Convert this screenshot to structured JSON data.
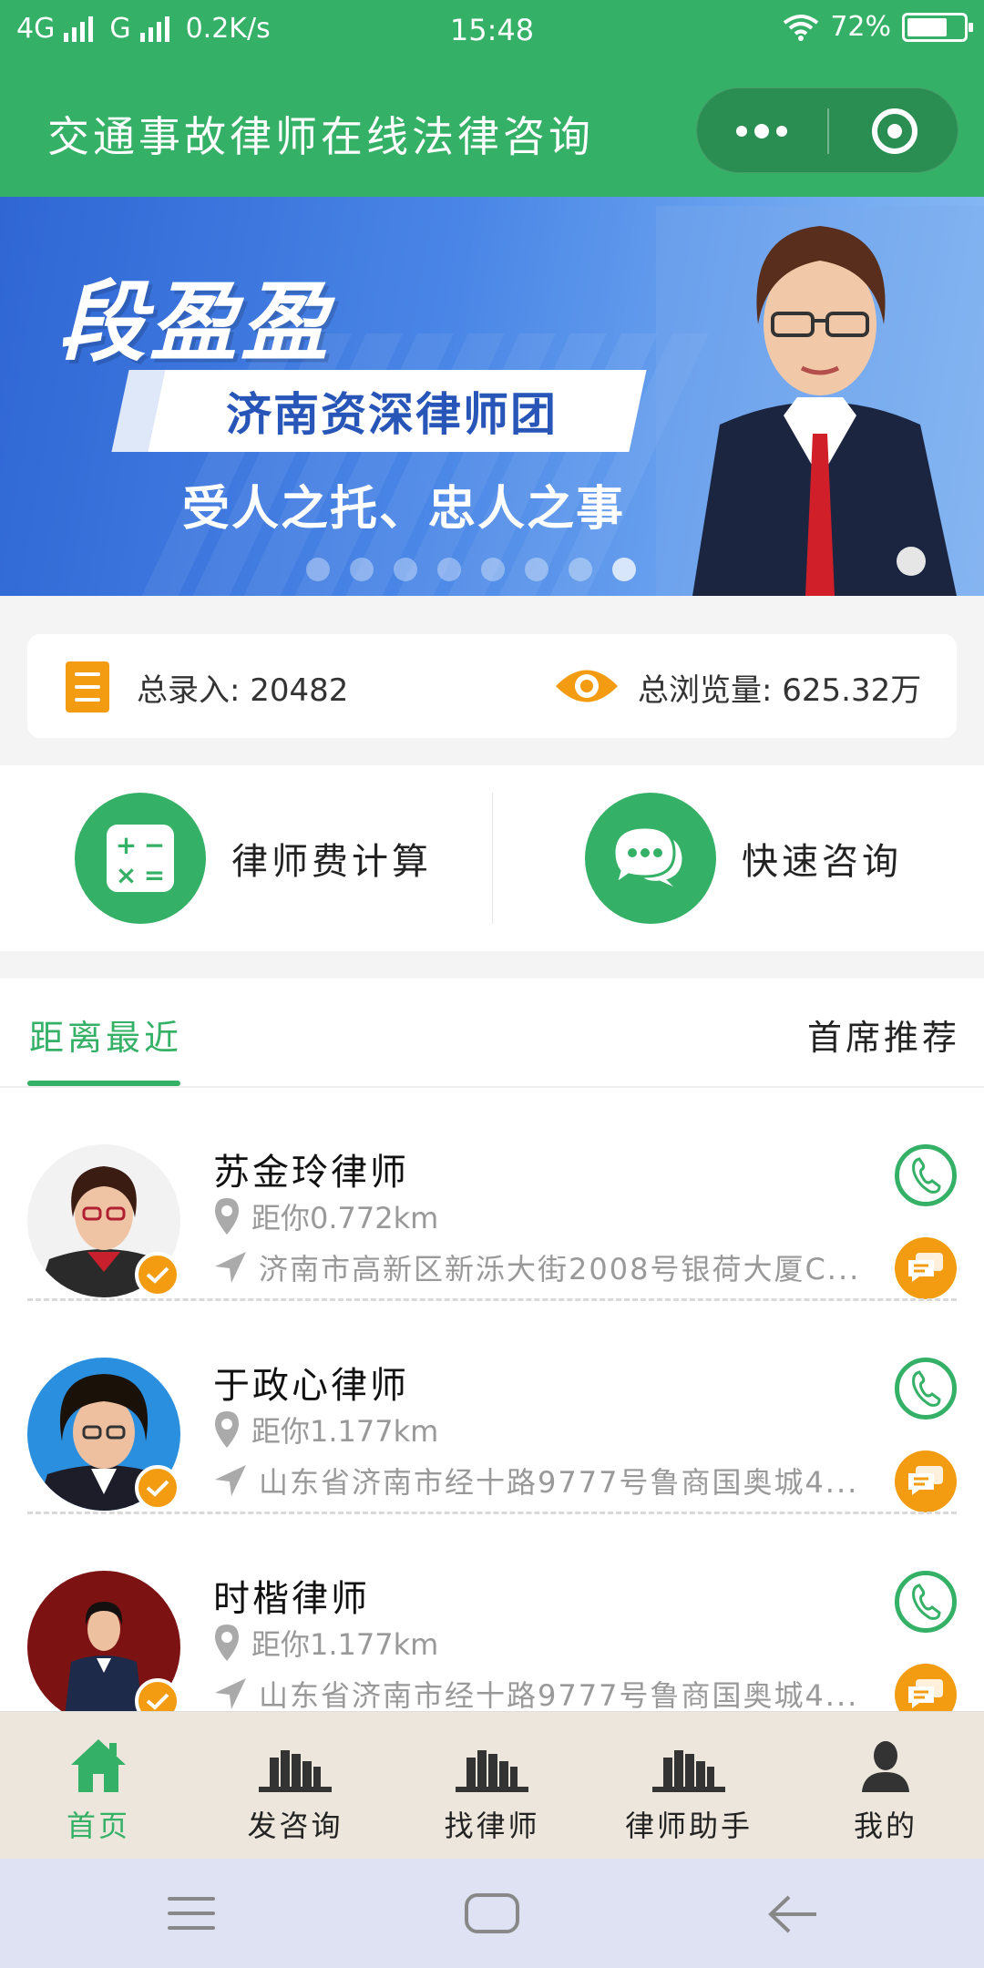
{
  "status_bar": {
    "network1": "4G",
    "network2": "G",
    "speed": "0.2K/s",
    "time": "15:48",
    "battery": "72%",
    "battery_level": 0.72
  },
  "header": {
    "title": "交通事故律师在线法律咨询",
    "brand_color": "#35b067"
  },
  "banner": {
    "name": "段盈盈",
    "tagline": "济南资深律师团",
    "slogan": "受人之托、忠人之事",
    "slide_count": 8,
    "active_slide": 8
  },
  "stats": {
    "entries_label": "总录入: 20482",
    "views_label": "总浏览量: 625.32万"
  },
  "actions": [
    {
      "label": "律师费计算",
      "icon": "calculator-icon"
    },
    {
      "label": "快速咨询",
      "icon": "chat-bubbles-icon"
    }
  ],
  "tabs": [
    {
      "label": "距离最近",
      "active": true
    },
    {
      "label": "首席推荐",
      "active": false
    }
  ],
  "lawyers": [
    {
      "name": "苏金玲律师",
      "distance": "距你0.772km",
      "address": "济南市高新区新泺大街2008号银荷大厦C..."
    },
    {
      "name": "于政心律师",
      "distance": "距你1.177km",
      "address": "山东省济南市经十路9777号鲁商国奥城4..."
    },
    {
      "name": "时楷律师",
      "distance": "距你1.177km",
      "address": "山东省济南市经十路9777号鲁商国奥城4..."
    }
  ],
  "bottom_nav": [
    {
      "label": "首页",
      "icon": "home-icon",
      "active": true
    },
    {
      "label": "发咨询",
      "icon": "books-icon",
      "active": false
    },
    {
      "label": "找律师",
      "icon": "books-icon",
      "active": false
    },
    {
      "label": "律师助手",
      "icon": "books-icon",
      "active": false
    },
    {
      "label": "我的",
      "icon": "user-icon",
      "active": false
    }
  ]
}
